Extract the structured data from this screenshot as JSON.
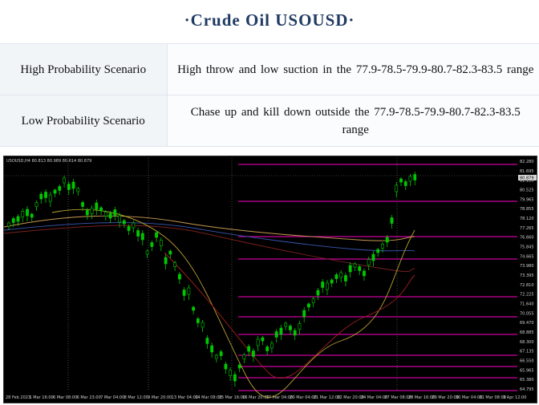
{
  "header": {
    "title": "·Crude  Oil  USOUSD·"
  },
  "scenarios": [
    {
      "label": "High Probability Scenario",
      "text": "High throw and low suction in the 77.9-78.5-79.9-80.7-82.3-83.5 range"
    },
    {
      "label": "Low Probability Scenario",
      "text": "Chase up and kill down outside the 77.9-78.5-79.9-80.7-82.3-83.5 range"
    }
  ],
  "chart": {
    "symbol_line": "USOUSD,H4  80.813 80.989 80.614 80.879",
    "price_labels": [
      "82.280",
      "81.695",
      "81.110",
      "80.525",
      "79.965",
      "78.855",
      "78.120",
      "77.265",
      "76.660",
      "75.845",
      "74.665",
      "73.980",
      "73.395",
      "72.810",
      "72.225",
      "71.640",
      "70.055",
      "69.470",
      "68.885",
      "68.300",
      "67.135",
      "66.550",
      "65.965",
      "65.380",
      "64.795"
    ],
    "current_price": "80.879",
    "date_labels": [
      "28 Feb 2023",
      "1 Mar 16:00",
      "6 Mar 08:00",
      "6 Mar 23:00",
      "7 Mar 04:00",
      "8 Mar 12:00",
      "9 Mar 20:00",
      "13 Mar 04:00",
      "14 Mar 08:00",
      "15 Mar 16:00",
      "16 Mar 20:00",
      "17 Mar 04:00",
      "20 Mar 04:00",
      "21 Mar 12:00",
      "22 Mar 20:00",
      "24 Mar 04:00",
      "27 Mar 08:00",
      "28 Mar 16:00",
      "29 Mar 20:00",
      "30 Mar 04:00",
      "31 Mar 08:00",
      "3 Apr 12:00"
    ],
    "colors": {
      "background": "#000000",
      "candle": "#00c800",
      "level_line": "#c8009c",
      "grid": "#404040"
    }
  }
}
